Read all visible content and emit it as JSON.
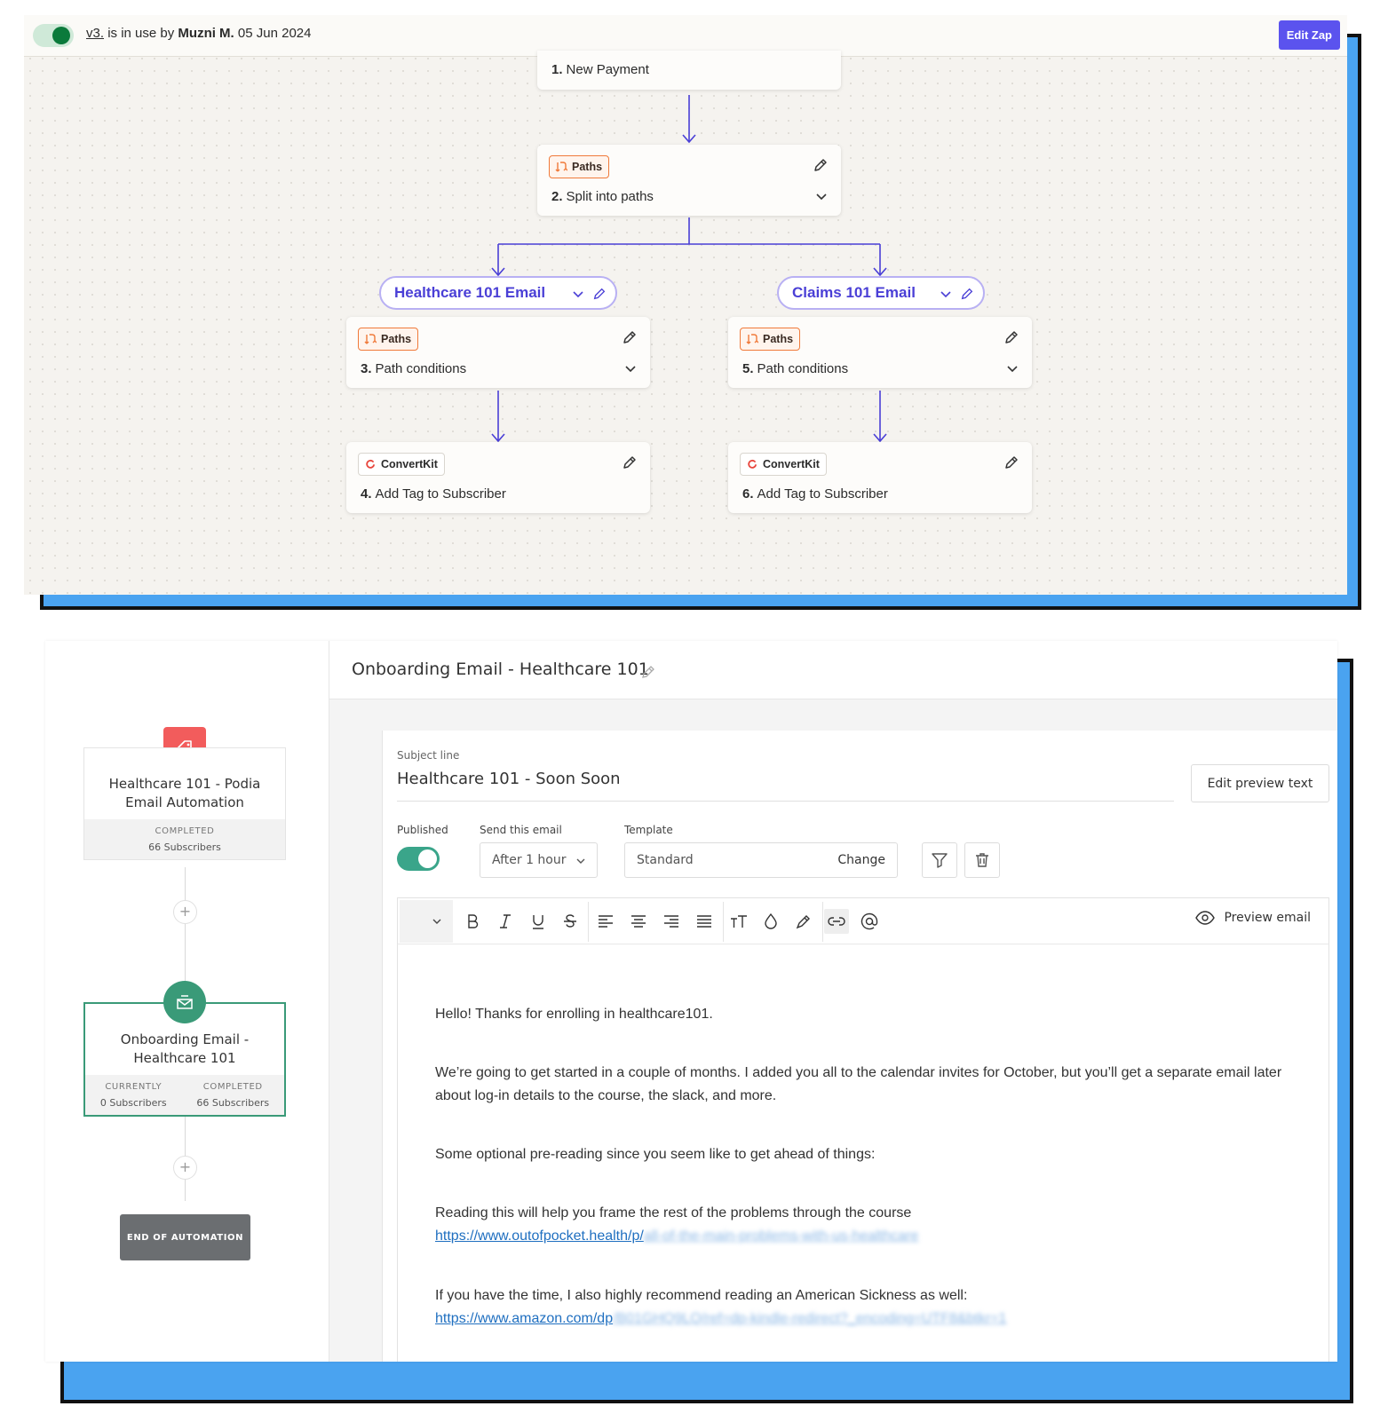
{
  "zap": {
    "version_link": "v3.",
    "status_text": "is in use by",
    "user": "Muzni M.",
    "date": "05 Jun 2024",
    "edit_button": "Edit Zap",
    "accent_color": "#5b53ee",
    "steps": [
      {
        "number": "1.",
        "title": "New Payment"
      },
      {
        "number": "2.",
        "title": "Split into paths",
        "app": "Paths"
      },
      {
        "number": "3.",
        "title": "Path conditions",
        "app": "Paths"
      },
      {
        "number": "4.",
        "title": "Add Tag to Subscriber",
        "app": "ConvertKit"
      },
      {
        "number": "5.",
        "title": "Path conditions",
        "app": "Paths"
      },
      {
        "number": "6.",
        "title": "Add Tag to Subscriber",
        "app": "ConvertKit"
      }
    ],
    "paths": [
      {
        "name": "Healthcare 101 Email"
      },
      {
        "name": "Claims 101 Email"
      }
    ]
  },
  "podia": {
    "sidebar": {
      "trigger": {
        "name": "Healthcare 101 - Podia Email Automation",
        "completed_label": "COMPLETED",
        "completed_value": "66 Subscribers",
        "icon": "tag-icon",
        "icon_color": "#f25c5c"
      },
      "email_node": {
        "name": "Onboarding Email - Healthcare 101",
        "currently_label": "CURRENTLY",
        "currently_value": "0 Subscribers",
        "completed_label": "COMPLETED",
        "completed_value": "66 Subscribers",
        "icon": "envelope-icon",
        "icon_color": "#3a9a78"
      },
      "add_label": "+",
      "end_label": "END OF AUTOMATION"
    },
    "header_title": "Onboarding Email - Healthcare 101",
    "subject_label": "Subject line",
    "subject_value": "Healthcare 101 - Soon Soon",
    "edit_preview_button": "Edit preview text",
    "published_label": "Published",
    "send_label": "Send this email",
    "send_value": "After 1 hour",
    "template_label": "Template",
    "template_value": "Standard",
    "template_change": "Change",
    "preview_button": "Preview email",
    "body": {
      "p1": "Hello! Thanks for enrolling in healthcare101.",
      "p2": "We’re going to get started in a couple of months. I added you all to the calendar invites for October, but you’ll get a separate email later about log-in details to the course, the slack, and more.",
      "p3": "Some optional pre-reading since you seem like to get ahead of things:",
      "p4": "Reading this will help you frame the rest of the problems through the course",
      "link1": "https://www.outofpocket.health/p/",
      "link1_blurred": "all-of-the-main-problems-with-us-healthcare",
      "p5": "If you have the time, I also highly recommend reading an American Sickness as well:",
      "link2": "https://www.amazon.com/dp",
      "link2_blurred": "/B01GHQ9LQ/ref=dp-kindle-redirect?_encoding=UTF8&btkr=1"
    }
  }
}
